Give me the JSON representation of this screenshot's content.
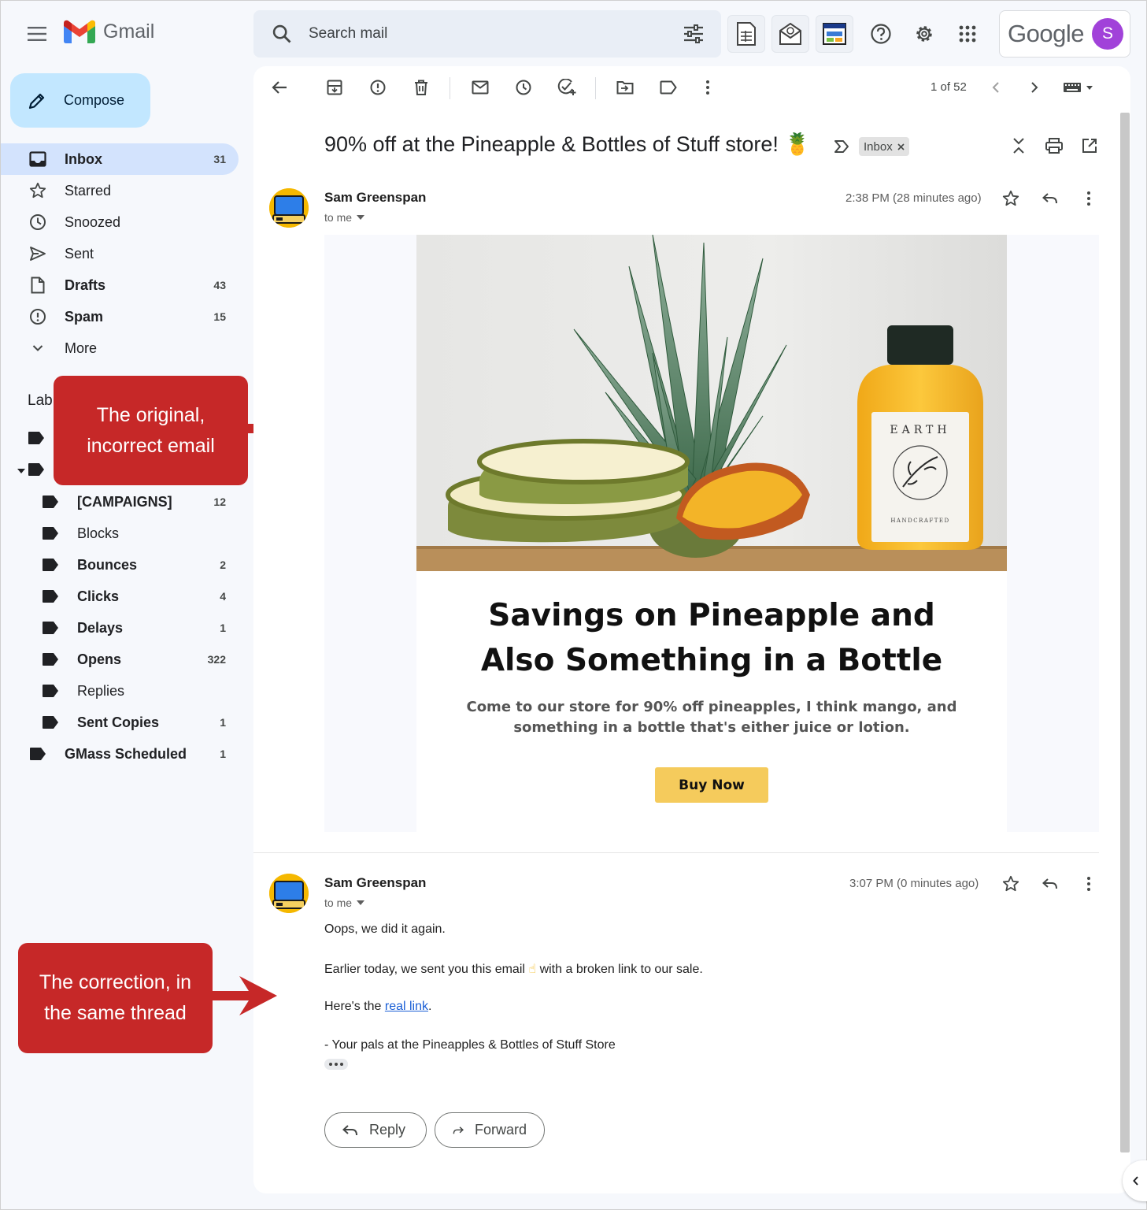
{
  "app": {
    "name": "Gmail",
    "account_word": "Google",
    "avatar_letter": "S"
  },
  "search": {
    "placeholder": "Search mail"
  },
  "compose_label": "Compose",
  "nav": [
    {
      "label": "Inbox",
      "count": "31",
      "icon": "inbox-icon",
      "active": true,
      "bold": true
    },
    {
      "label": "Starred",
      "count": "",
      "icon": "star-icon"
    },
    {
      "label": "Snoozed",
      "count": "",
      "icon": "clock-icon"
    },
    {
      "label": "Sent",
      "count": "",
      "icon": "send-icon"
    },
    {
      "label": "Drafts",
      "count": "43",
      "icon": "draft-icon",
      "bold": true
    },
    {
      "label": "Spam",
      "count": "15",
      "icon": "spam-icon",
      "bold": true
    },
    {
      "label": "More",
      "count": "",
      "icon": "chevron-down-icon"
    }
  ],
  "labels_heading": "Lab",
  "labels": [
    {
      "label": "[CAMPAIGNS]",
      "count": "12",
      "bold": true,
      "sub": true
    },
    {
      "label": "Blocks",
      "count": "",
      "bold": false,
      "sub": true
    },
    {
      "label": "Bounces",
      "count": "2",
      "bold": true,
      "sub": true
    },
    {
      "label": "Clicks",
      "count": "4",
      "bold": true,
      "sub": true
    },
    {
      "label": "Delays",
      "count": "1",
      "bold": true,
      "sub": true
    },
    {
      "label": "Opens",
      "count": "322",
      "bold": true,
      "sub": true
    },
    {
      "label": "Replies",
      "count": "",
      "bold": false,
      "sub": true
    },
    {
      "label": "Sent Copies",
      "count": "1",
      "bold": true,
      "sub": true
    },
    {
      "label": "GMass Scheduled",
      "count": "1",
      "bold": true,
      "sub": false
    }
  ],
  "callouts": {
    "original": [
      "The original,",
      "incorrect email"
    ],
    "correction": [
      "The correction, in",
      "the same thread"
    ]
  },
  "toolbar": {
    "pager": "1 of 52"
  },
  "thread": {
    "subject": "90% off at the Pineapple & Bottles of Stuff store! 🍍",
    "label_chip": "Inbox"
  },
  "message1": {
    "sender": "Sam Greenspan",
    "to": "to me",
    "time": "2:38 PM (28 minutes ago)",
    "bottle_label": "EARTH",
    "bottle_sub": "HANDCRAFTED",
    "headline": [
      "Savings on Pineapple and",
      "Also Something in a Bottle"
    ],
    "subline": [
      "Come to our store for 90% off pineapples, I think mango, and",
      "something in a bottle that's either juice or lotion."
    ],
    "button": "Buy Now"
  },
  "message2": {
    "sender": "Sam Greenspan",
    "to": "to me",
    "time": "3:07 PM (0 minutes ago)",
    "p1": "Oops, we did it again.",
    "p2_before": "Earlier today, we sent you this email ",
    "p2_emoji": "☝",
    "p2_after": " with a broken link to our sale.",
    "p3_before": "Here's the ",
    "p3_link": "real link",
    "p3_after": ".",
    "p4": "- Your pals at the Pineapples & Bottles of Stuff Store"
  },
  "actions": {
    "reply": "Reply",
    "forward": "Forward"
  },
  "colors": {
    "accent": "#c2e7ff",
    "active_nav": "#d3e3fd",
    "callout": "#c62828",
    "button": "#f5cb5c",
    "avatar": "#a142d9"
  }
}
